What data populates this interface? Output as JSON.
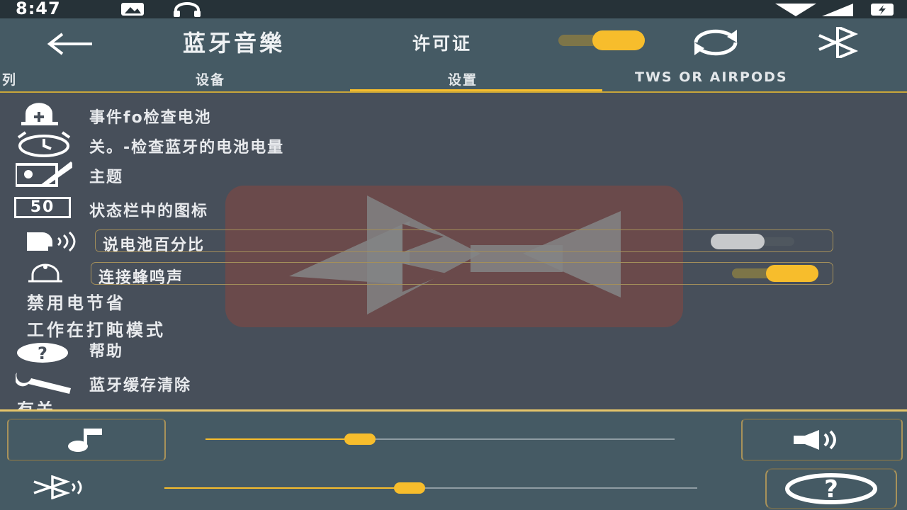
{
  "status_bar": {
    "time": "8:47"
  },
  "app_bar": {
    "title": "蓝牙音樂",
    "license_label": "许可证",
    "license_toggle_on": true
  },
  "tabs": [
    {
      "label": "列"
    },
    {
      "label": "设备"
    },
    {
      "label": "设置",
      "selected": true
    },
    {
      "label": "TWS OR AIRPODS"
    }
  ],
  "settings": {
    "event_battery_check": {
      "label": "事件fo检查电池"
    },
    "battery_check_schedule": {
      "label": "关。-检查蓝牙的电池电量"
    },
    "theme": {
      "label": "主题"
    },
    "statusbar_icon": {
      "label": "状态栏中的图标",
      "icon_text": "50"
    },
    "speak_battery_percent": {
      "label": "说电池百分比",
      "on": false
    },
    "connect_beep": {
      "label": "连接蜂鸣声",
      "on": true
    },
    "disable_power_saving": {
      "label": "禁用电节省"
    },
    "work_in_doze": {
      "label": "工作在打盹模式"
    },
    "help": {
      "label": "帮助"
    },
    "clear_bt_cache": {
      "label": "蓝牙缓存清除"
    },
    "about": {
      "label": "有关"
    }
  },
  "controls": {
    "music_volume": 0.33,
    "bluetooth_volume": 0.46
  },
  "colors": {
    "accent": "#f7bd2c",
    "app_bar": "#455a64",
    "background": "#474f5a",
    "status_bar": "#263238"
  }
}
